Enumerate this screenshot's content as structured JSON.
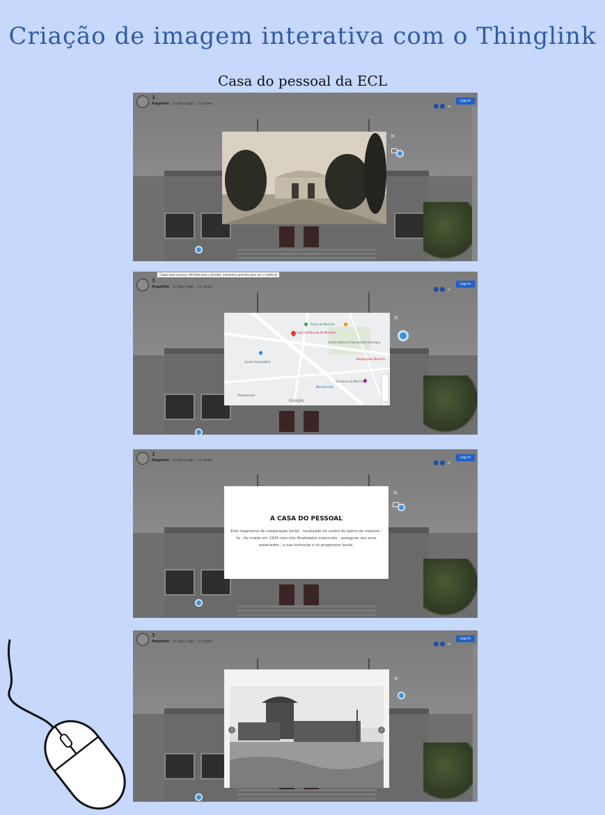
{
  "title": "Criação de imagem interativa com o Thinglink",
  "subtitle": "Casa do pessoal da ECL",
  "viewer": {
    "user_number": "1",
    "author": "Angelina",
    "meta_suffix": "· 13 days ago · 11 views",
    "login_label": "Log In",
    "close_glyph": "×"
  },
  "tooltip_text": "Clique para avançar (Ali-Seta para a direita), mantenha premido para ver o histórico",
  "map": {
    "brand": "Google",
    "labels": [
      "Casa do Pessoal da Marinha",
      "Praça da Marinha",
      "Escola Básica e Secundária Henrique",
      "Reparações Marinha",
      "Escola Secundária",
      "Farmácia da Marinha",
      "Marinha Lda",
      "Restaurante"
    ],
    "pin_colors": [
      "#e53935",
      "#43a047",
      "#fb8c00",
      "#1e88e5",
      "#8e24aa"
    ]
  },
  "info_card": {
    "heading": "A CASA DO PESSOAL",
    "body": "Este organismo de cooperação social , localizado no centro do bairro de maceira - liz , foi criado em 1934 com três finalidades essenciais , assegurar aos seus associados , a sua instrução e os progressos locais."
  },
  "nav": {
    "prev": "‹",
    "next": "›"
  },
  "colors": {
    "page_bg": "#c6d8fb",
    "title_blue": "#2f5aa6",
    "hotspot": "#3d8fd6",
    "login": "#1f62c6"
  }
}
